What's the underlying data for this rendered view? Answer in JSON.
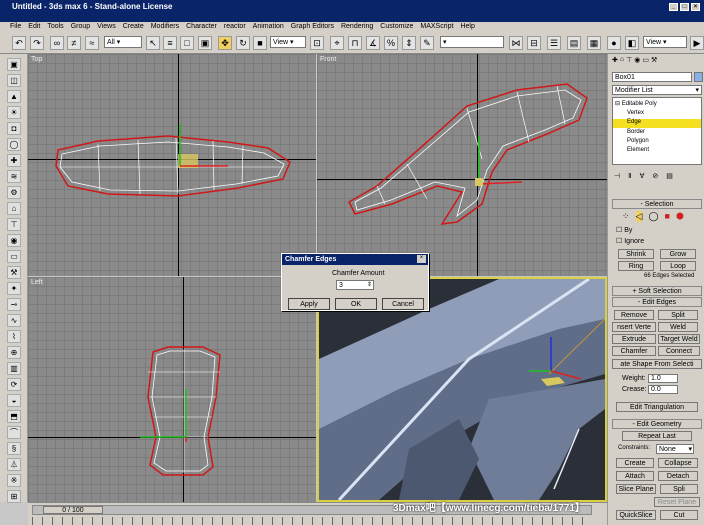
{
  "app": {
    "title": "Untitled - 3ds max 6 - Stand-alone License"
  },
  "menu": [
    "File",
    "Edit",
    "Tools",
    "Group",
    "Views",
    "Create",
    "Modifiers",
    "Character",
    "reactor",
    "Animation",
    "Graph Editors",
    "Rendering",
    "Customize",
    "MAXScript",
    "Help"
  ],
  "toolbar": {
    "selection_filter": "All",
    "ref_coord": "View",
    "view_right": "View"
  },
  "viewports": {
    "top": "Top",
    "front": "Front",
    "left": "Left"
  },
  "dialog": {
    "title": "Chamfer Edges",
    "label": "Chamfer Amount",
    "value": "3",
    "apply": "Apply",
    "ok": "OK",
    "cancel": "Cancel"
  },
  "command_panel": {
    "object_name": "Box01",
    "modifier_list": "Modifier List",
    "stack": {
      "root": "Editable Poly",
      "items": [
        "Vertex",
        "Edge",
        "Border",
        "Polygon",
        "Element"
      ],
      "selected": "Edge"
    },
    "selection": {
      "header": "Selection",
      "by": "By",
      "ignore": "Ignore",
      "shrink": "Shrink",
      "grow": "Grow",
      "ring": "Ring",
      "loop": "Loop",
      "status": "66 Edges Selected"
    },
    "soft_selection": "Soft Selection",
    "edit_edges": {
      "header": "Edit Edges",
      "remove": "Remove",
      "split": "Split",
      "insert_vertex": "nsert Verte",
      "weld": "Weld",
      "extrude": "Extrude",
      "target_weld": "Target Weld",
      "chamfer": "Chamfer",
      "connect": "Connect",
      "create_shape": "ate Shape From Selecti",
      "weight_label": "Weight:",
      "weight": "1.0",
      "crease_label": "Crease:",
      "crease": "0.0",
      "edit_tri": "Edit Triangulation"
    },
    "edit_geometry": {
      "header": "Edit Geometry",
      "repeat_last": "Repeat Last",
      "constraints_label": "Constraints:",
      "constraints": "None",
      "create": "Create",
      "collapse": "Collapse",
      "attach": "Attach",
      "detach": "Detach",
      "slice_plane": "Slice Plane",
      "split": "Spli",
      "reset_plane": "Reset Plane",
      "quickslice": "QuickSlice",
      "cut": "Cut"
    }
  },
  "timeline": {
    "frame": "0 / 100"
  },
  "watermark": "3Dmax吧【www.linecg.com/tieba/1771】"
}
